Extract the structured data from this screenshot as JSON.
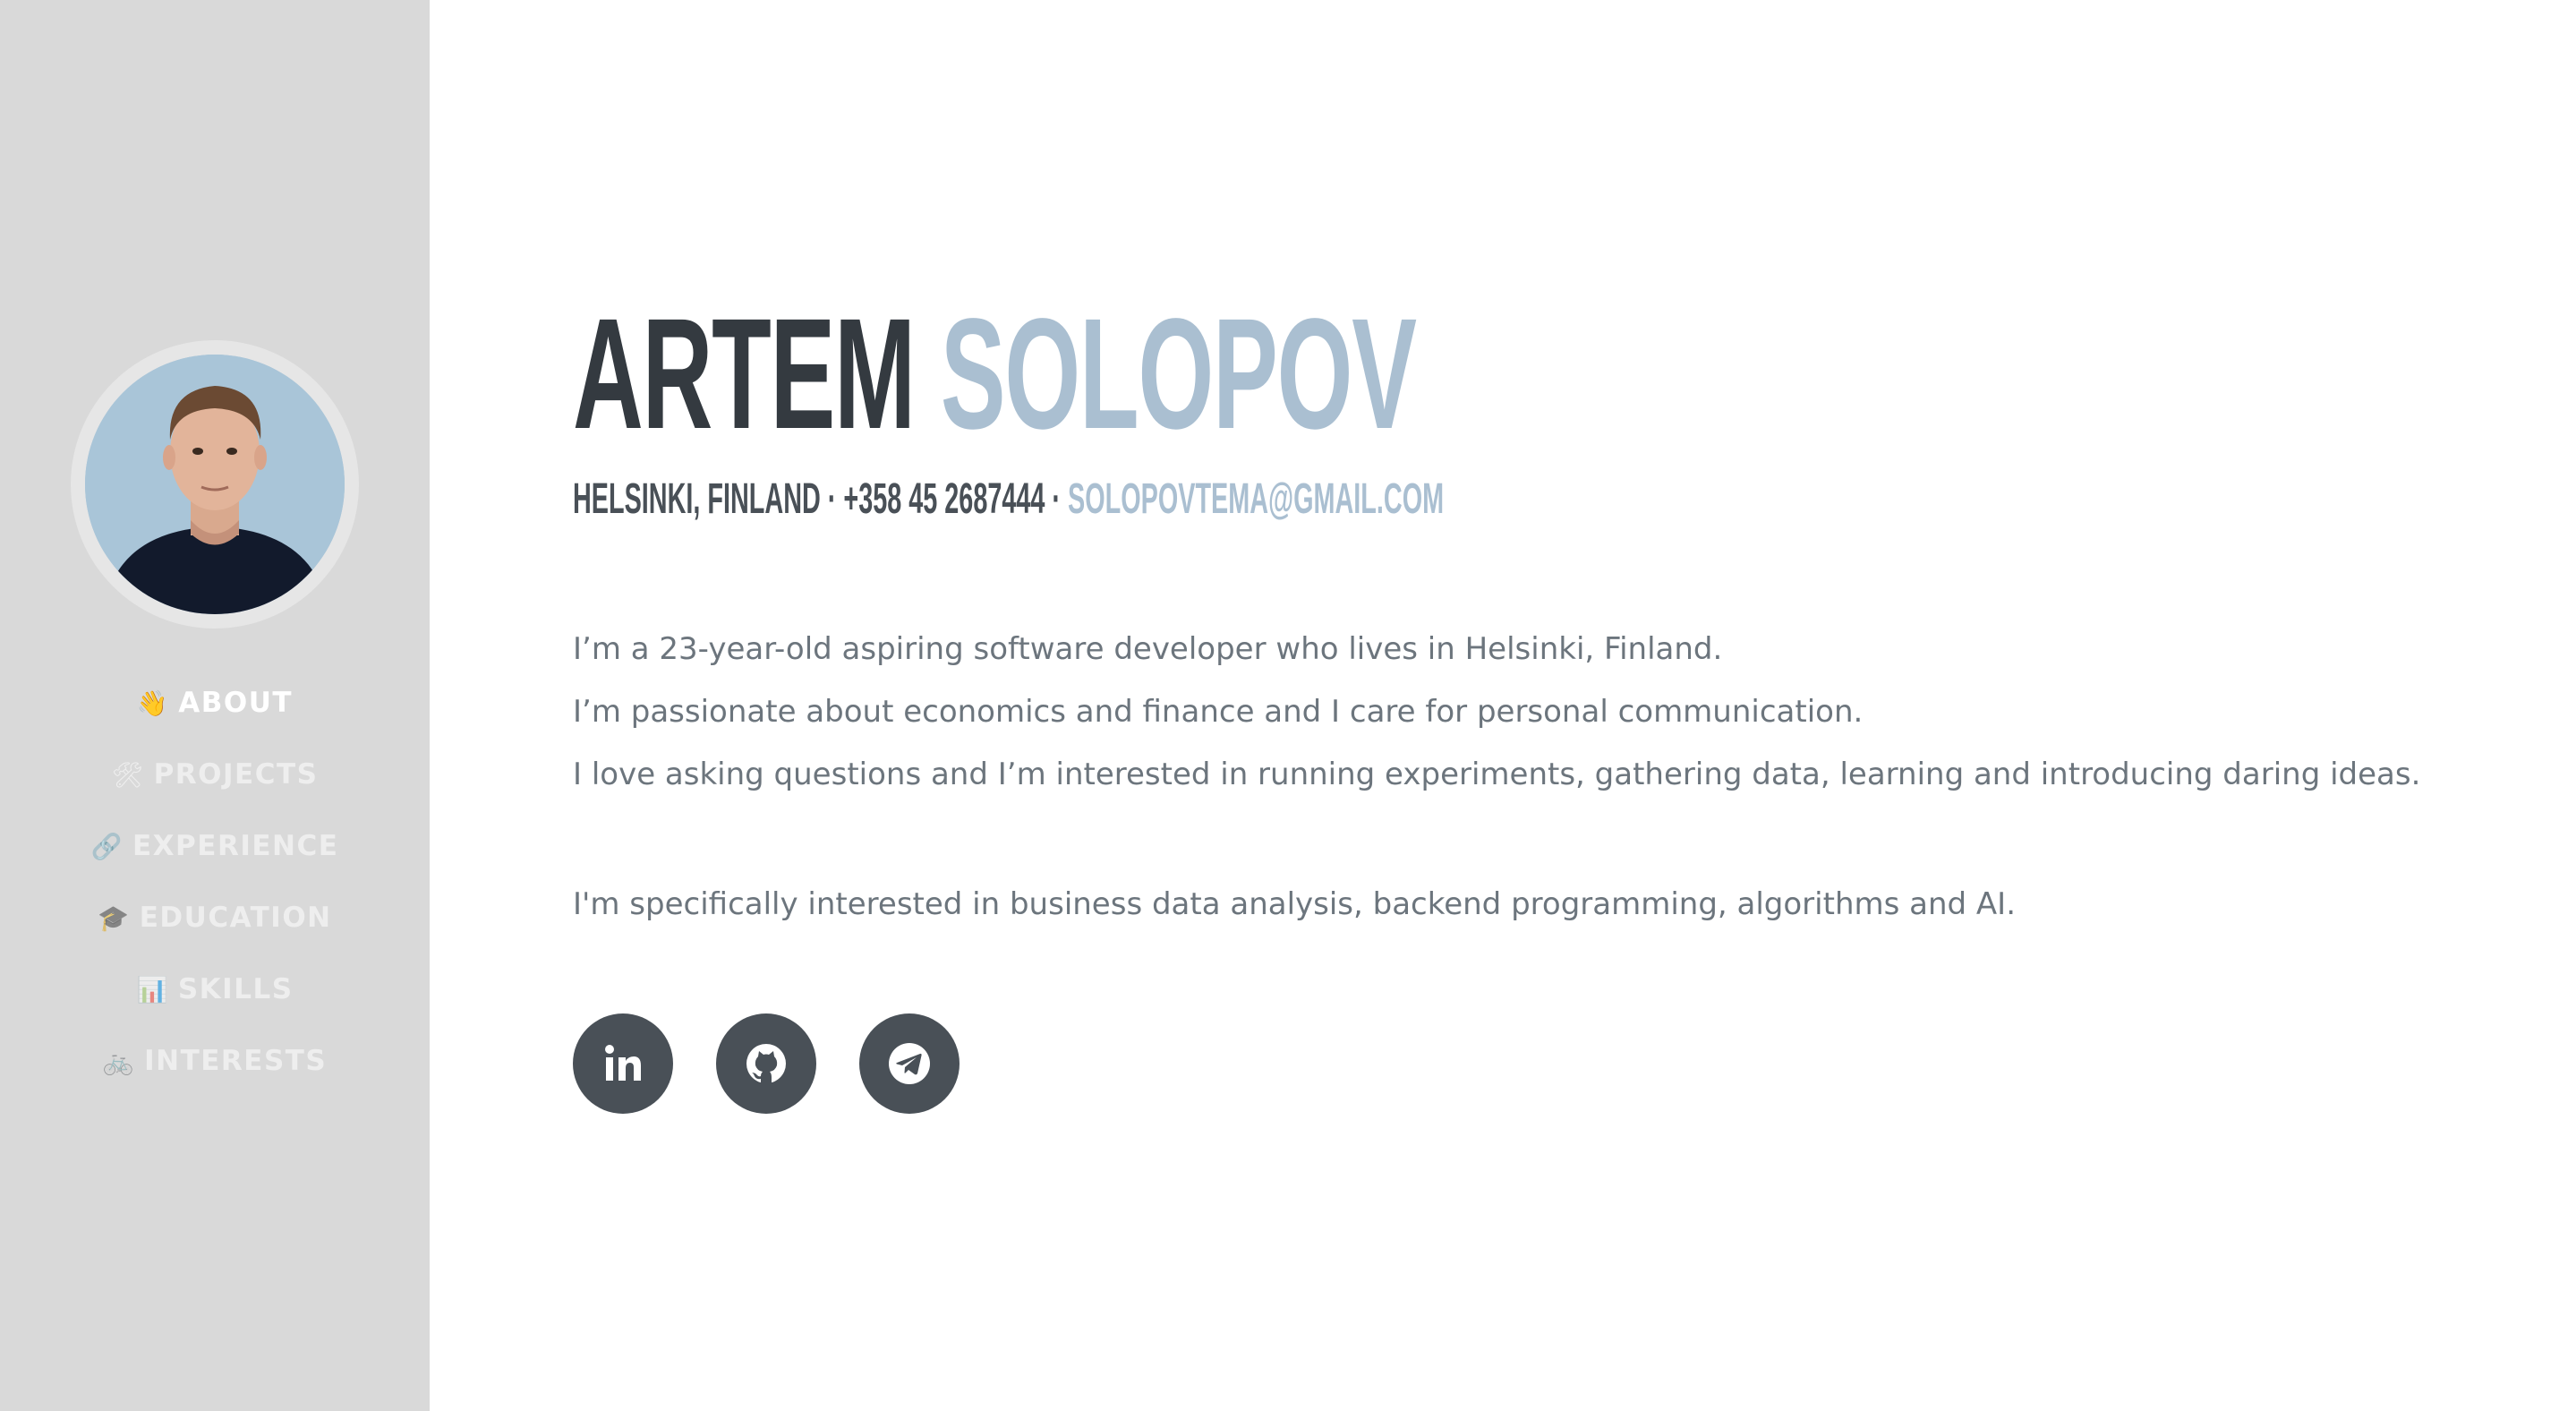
{
  "sidebar": {
    "avatar_alt": "profile photo",
    "nav": [
      {
        "emoji": "👋",
        "label": "About",
        "active": true
      },
      {
        "emoji": "🛠",
        "label": "Projects",
        "active": false
      },
      {
        "emoji": "🔗",
        "label": "Experience",
        "active": false
      },
      {
        "emoji": "🎓",
        "label": "Education",
        "active": false
      },
      {
        "emoji": "📊",
        "label": "Skills",
        "active": false
      },
      {
        "emoji": "🚲",
        "label": "Interests",
        "active": false
      }
    ]
  },
  "header": {
    "first_name": "ARTEM",
    "last_name": "SOLOPOV",
    "contact_location": "HELSINKI, FINLAND · +358 45 2687444 · ",
    "contact_email": "SOLOPOVTEMA@GMAIL.COM"
  },
  "bio": {
    "line1": "I’m a 23-year-old aspiring software developer who lives in Helsinki, Finland.",
    "line2": "I’m passionate about economics and finance and I care for personal communication.",
    "line3": "I love asking questions and I’m interested in running experiments, gathering data, learning and introducing daring ideas.",
    "interests": "I'm specifically interested in business data analysis, backend programming, algorithms and AI."
  },
  "socials": [
    {
      "icon": "linkedin-icon"
    },
    {
      "icon": "github-icon"
    },
    {
      "icon": "telegram-icon"
    }
  ],
  "colors": {
    "sidebar_bg": "#d9d9d9",
    "accent": "#aabfd1",
    "dark": "#343a40",
    "text": "#6c757d",
    "social_bg": "#495057"
  }
}
